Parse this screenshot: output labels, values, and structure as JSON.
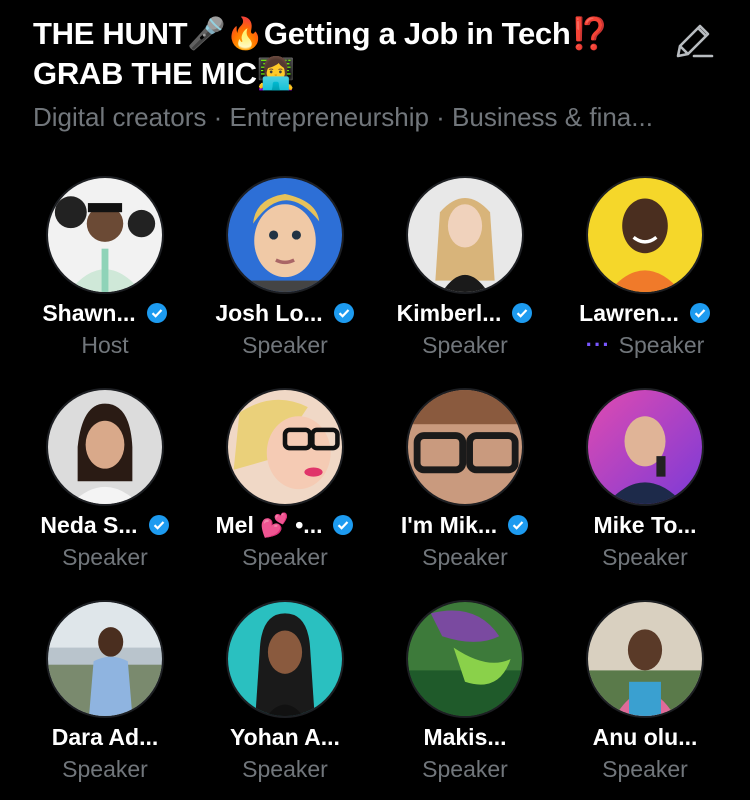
{
  "space": {
    "title": "THE HUNT🎤🔥Getting a Job in Tech⁉️GRAB THE MIC👩‍💻",
    "topics": "Digital creators · Entrepreneurship · Business & fina..."
  },
  "colors": {
    "verified": "#1d9bf0",
    "speaking": "#7856ff",
    "muted_text": "#71767b"
  },
  "participants": [
    {
      "name": "Shawn...",
      "role": "Host",
      "verified": true
    },
    {
      "name": "Josh Lo...",
      "role": "Speaker",
      "verified": true
    },
    {
      "name": "Kimberl...",
      "role": "Speaker",
      "verified": true
    },
    {
      "name": "Lawren...",
      "role": "Speaker",
      "verified": true,
      "speaking": true
    },
    {
      "name": "Neda S...",
      "role": "Speaker",
      "verified": true
    },
    {
      "name": "Mel 💕 •...",
      "role": "Speaker",
      "verified": true
    },
    {
      "name": "I'm Mik...",
      "role": "Speaker",
      "verified": true
    },
    {
      "name": "Mike To...",
      "role": "Speaker",
      "verified": false
    },
    {
      "name": "Dara Ad...",
      "role": "Speaker",
      "verified": false
    },
    {
      "name": "Yohan A...",
      "role": "Speaker",
      "verified": false
    },
    {
      "name": "Makis...",
      "role": "Speaker",
      "verified": false
    },
    {
      "name": "Anu olu...",
      "role": "Speaker",
      "verified": false
    }
  ]
}
